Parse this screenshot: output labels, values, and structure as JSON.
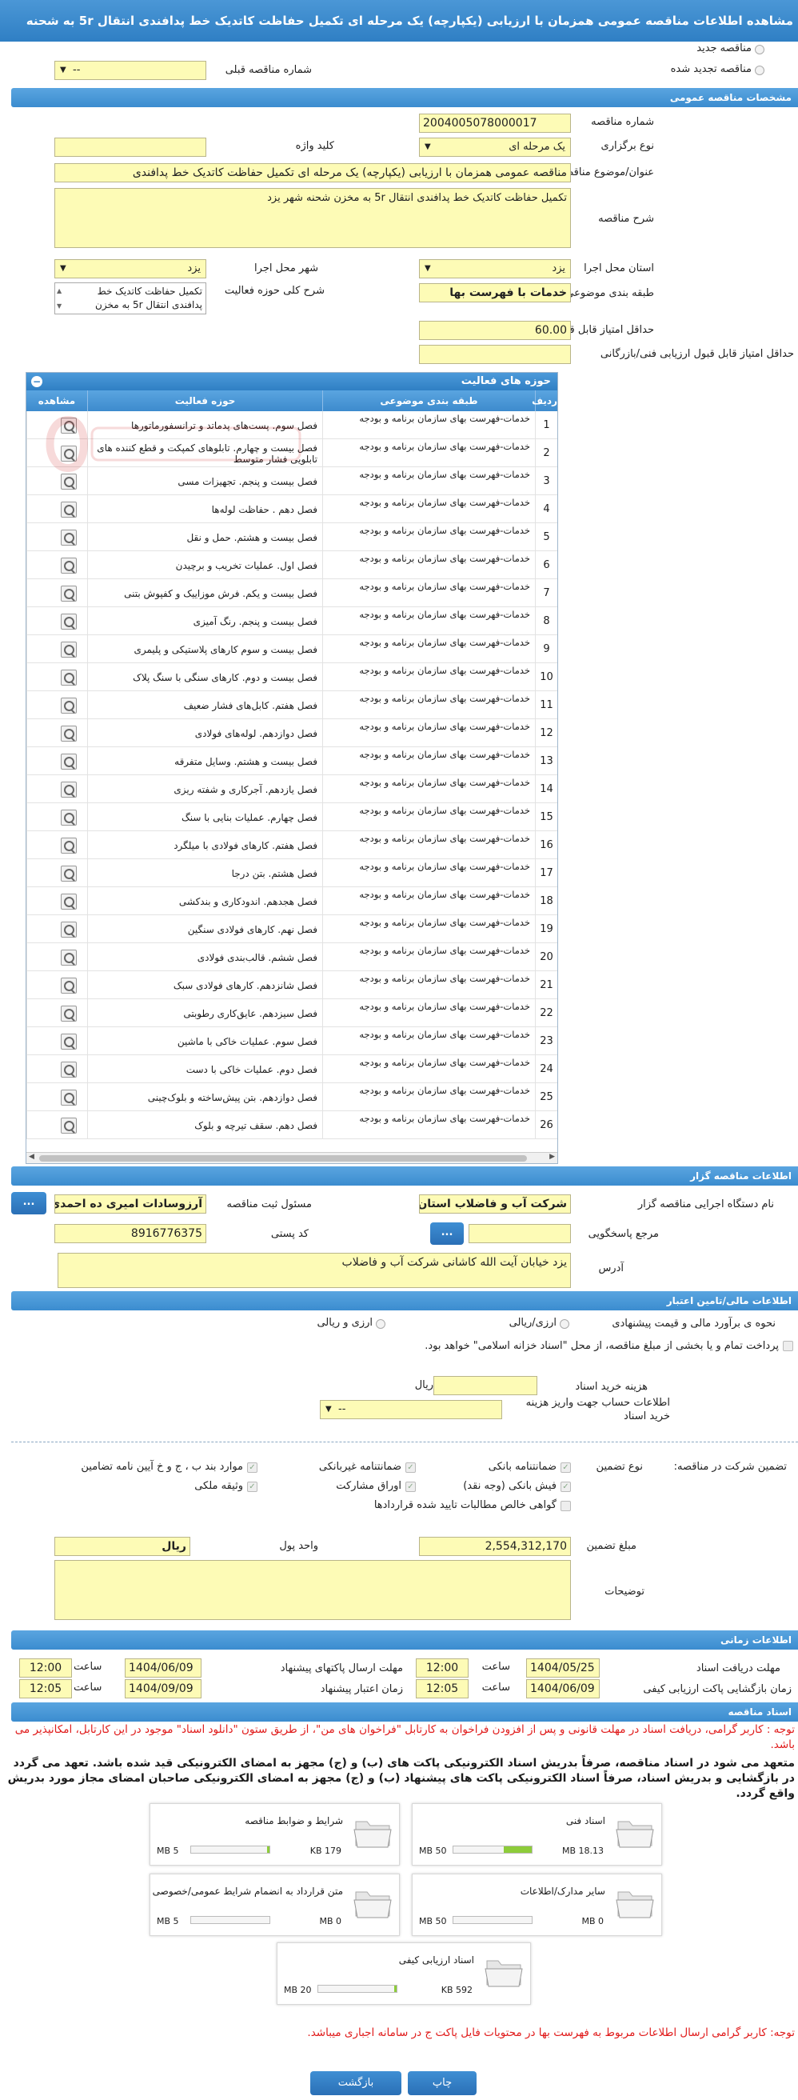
{
  "title": "مشاهده اطلاعات مناقصه عمومی همزمان با ارزیابی (یکپارچه) یک مرحله ای تکمیل حفاظت کاتدیک خط پدافندی انتقال 5r به شحنه",
  "top": {
    "new_tender": "مناقصه جدید",
    "renewed_tender": "مناقصه تجدید شده",
    "prev_number_label": "شماره مناقصه قبلی",
    "prev_number_value": "--"
  },
  "general": {
    "section": "مشخصات مناقصه عمومی",
    "number_label": "شماره مناقصه",
    "number_value": "2004005078000017",
    "type_label": "نوع برگزاری",
    "type_value": "یک مرحله ای",
    "keyword_label": "کلید واژه",
    "keyword_value": "",
    "subject_label": "عنوان/موضوع مناقصه",
    "subject_value": "مناقصه عمومی همزمان با ارزیابی (یکپارچه) یک مرحله ای تکمیل حفاظت کاتدیک خط پدافندی",
    "desc_label": "شرح مناقصه",
    "desc_value": "تکمیل حفاظت کاتدیک خط پدافندی انتقال 5r به مخزن شحنه شهر یزد",
    "province_label": "استان محل اجرا",
    "province_value": "یزد",
    "city_label": "شهر محل اجرا",
    "city_value": "یزد",
    "category_label": "طبقه بندی موضوعی",
    "category_value": "خدمات با فهرست بها",
    "activity_label": "شرح کلی حوزه فعالیت",
    "activity_value": "تکمیل حفاظت کاتدیک خط پدافندی انتقال 5r به مخزن",
    "min_quality_label": "حداقل امتیاز قابل قبول ارزیابی کیفی",
    "min_quality_value": "60.00",
    "min_tech_label": "حداقل امتیاز قابل قبول ارزیابی فنی/بازرگانی",
    "min_tech_value": ""
  },
  "grid": {
    "title": "حوزه های فعالیت",
    "col_row": "ردیف",
    "col_category": "طبقه بندی موضوعی",
    "col_activity": "حوزه فعالیت",
    "col_view": "مشاهده",
    "rows": [
      {
        "n": "1",
        "cat": "خدمات-فهرست بهای سازمان برنامه و بودجه",
        "act": "فصل سوم. پست‌های پدماتد و ترانسفورماتورها"
      },
      {
        "n": "2",
        "cat": "خدمات-فهرست بهای سازمان برنامه و بودجه",
        "act": "فصل بیست و چهارم. تابلوهای کمپکت و قطع کننده های تابلویی فشار متوسط"
      },
      {
        "n": "3",
        "cat": "خدمات-فهرست بهای سازمان برنامه و بودجه",
        "act": "فصل بیست و پنجم. تجهیزات مسی"
      },
      {
        "n": "4",
        "cat": "خدمات-فهرست بهای سازمان برنامه و بودجه",
        "act": "فصل دهم . حفاظت لوله‌ها"
      },
      {
        "n": "5",
        "cat": "خدمات-فهرست بهای سازمان برنامه و بودجه",
        "act": "فصل بیست و هشتم. حمل و نقل"
      },
      {
        "n": "6",
        "cat": "خدمات-فهرست بهای سازمان برنامه و بودجه",
        "act": "فصل اول. عملیات تخریب و برچیدن"
      },
      {
        "n": "7",
        "cat": "خدمات-فهرست بهای سازمان برنامه و بودجه",
        "act": "فصل بیست و یکم. فرش موزاییک و کفپوش بتنی"
      },
      {
        "n": "8",
        "cat": "خدمات-فهرست بهای سازمان برنامه و بودجه",
        "act": "فصل بیست و پنجم. رنگ آمیزی"
      },
      {
        "n": "9",
        "cat": "خدمات-فهرست بهای سازمان برنامه و بودجه",
        "act": "فصل بیست و سوم کارهای پلاستیکی و پلیمری"
      },
      {
        "n": "10",
        "cat": "خدمات-فهرست بهای سازمان برنامه و بودجه",
        "act": "فصل بیست و دوم. کارهای سنگی با سنگ پلاک"
      },
      {
        "n": "11",
        "cat": "خدمات-فهرست بهای سازمان برنامه و بودجه",
        "act": "فصل هفتم. کابل‌های فشار ضعیف"
      },
      {
        "n": "12",
        "cat": "خدمات-فهرست بهای سازمان برنامه و بودجه",
        "act": "فصل دوازدهم. لوله‌های فولادی"
      },
      {
        "n": "13",
        "cat": "خدمات-فهرست بهای سازمان برنامه و بودجه",
        "act": "فصل بیست و هشتم. وسایل متفرقه"
      },
      {
        "n": "14",
        "cat": "خدمات-فهرست بهای سازمان برنامه و بودجه",
        "act": "فصل یازدهم. آجرکاری و شفته ریزی"
      },
      {
        "n": "15",
        "cat": "خدمات-فهرست بهای سازمان برنامه و بودجه",
        "act": "فصل چهارم. عملیات بنایی با سنگ"
      },
      {
        "n": "16",
        "cat": "خدمات-فهرست بهای سازمان برنامه و بودجه",
        "act": "فصل هفتم. کارهای فولادی با میلگرد"
      },
      {
        "n": "17",
        "cat": "خدمات-فهرست بهای سازمان برنامه و بودجه",
        "act": "فصل هشتم. بتن درجا"
      },
      {
        "n": "18",
        "cat": "خدمات-فهرست بهای سازمان برنامه و بودجه",
        "act": "فصل هجدهم. اندودکاری و بندکشی"
      },
      {
        "n": "19",
        "cat": "خدمات-فهرست بهای سازمان برنامه و بودجه",
        "act": "فصل نهم. کارهای فولادی سنگین"
      },
      {
        "n": "20",
        "cat": "خدمات-فهرست بهای سازمان برنامه و بودجه",
        "act": "فصل ششم. قالب‌بندی فولادی"
      },
      {
        "n": "21",
        "cat": "خدمات-فهرست بهای سازمان برنامه و بودجه",
        "act": "فصل شانزدهم. کارهای فولادی سبک"
      },
      {
        "n": "22",
        "cat": "خدمات-فهرست بهای سازمان برنامه و بودجه",
        "act": "فصل سیزدهم. عایق‌کاری رطوبتی"
      },
      {
        "n": "23",
        "cat": "خدمات-فهرست بهای سازمان برنامه و بودجه",
        "act": "فصل سوم. عملیات خاکی با ماشین"
      },
      {
        "n": "24",
        "cat": "خدمات-فهرست بهای سازمان برنامه و بودجه",
        "act": "فصل دوم. عملیات خاکی با دست"
      },
      {
        "n": "25",
        "cat": "خدمات-فهرست بهای سازمان برنامه و بودجه",
        "act": "فصل دوازدهم. بتن پیش‌ساخته و بلوک‌چینی"
      },
      {
        "n": "26",
        "cat": "خدمات-فهرست بهای سازمان برنامه و بودجه",
        "act": "فصل دهم. سقف تیرچه و بلوک"
      }
    ]
  },
  "org": {
    "section": "اطلاعات مناقصه گزار",
    "org_label": "نام دستگاه اجرایی مناقصه گزار",
    "org_value": "شرکت آب و فاضلاب استان",
    "responsible_label": "مسئول ثبت مناقصه",
    "responsible_value": "آرزوسادات امیری ده احمدی",
    "ref_label": "مرجع پاسخگویی",
    "ref_value": "",
    "dots": "...",
    "postal_label": "کد پستی",
    "postal_value": "8916776375",
    "address_label": "آدرس",
    "address_value": "یزد خیابان آیت الله کاشانی شرکت آب و فاضلاب"
  },
  "finance": {
    "section": "اطلاعات مالی/تامین اعتبار",
    "estimate_label": "نحوه ی برآورد مالی و قیمت پیشنهادی",
    "rial_opt": "ارزی/ریالی",
    "rial2_opt": "ارزی و ریالی",
    "treasury_text": "پرداخت تمام و یا بخشی از مبلغ مناقصه، از محل \"اسناد خزانه اسلامی\" خواهد بود.",
    "doc_fee_label": "هزینه خرید اسناد",
    "doc_fee_unit": "ریال",
    "account_label": "اطلاعات حساب جهت واریز هزینه خرید اسناد",
    "account_value": "--",
    "guarantee_label": "تضمین شرکت در مناقصه:",
    "guarantee_type": "نوع تضمین",
    "g1": "ضمانتنامه بانکی",
    "g2": "ضمانتنامه غیربانکی",
    "g3": "موارد بند ب ، ج و خ آیین نامه تضامین",
    "g4": "فیش بانکی (وجه نقد)",
    "g5": "اوراق مشارکت",
    "g6": "وثیقه ملکی",
    "g7": "گواهی خالص مطالبات تایید شده قراردادها",
    "amount_label": "مبلغ تضمین",
    "amount_value": "2,554,312,170",
    "currency_label": "واحد پول",
    "currency_value": "ریال",
    "notes_label": "توضیحات",
    "notes_value": ""
  },
  "time": {
    "section": "اطلاعات زمانی",
    "receive_label": "مهلت دریافت اسناد",
    "receive_date": "1404/05/25",
    "receive_time": "12:00",
    "send_label": "مهلت ارسال پاکتهای پیشنهاد",
    "send_date": "1404/06/09",
    "send_time": "12:00",
    "open_label": "زمان بازگشایی پاکت ارزیابی کیفی",
    "open_date": "1404/06/09",
    "open_time": "12:05",
    "validity_label": "زمان اعتبار پیشنهاد",
    "validity_date": "1404/09/09",
    "validity_time": "12:05",
    "time_word": "ساعت"
  },
  "docs": {
    "section": "اسناد مناقصه",
    "note": "توجه : کاربر گرامی، دریافت اسناد در مهلت قانونی و پس از افزودن فراخوان به کارتابل \"فراخوان های من\"، از طریق ستون \"دانلود اسناد\" موجود در این کارتابل، امکانپذیر می باشد.",
    "commit": "متعهد می شود در اسناد مناقصه، صرفاً بدریش اسناد الکترونیکی پاکت های (ب) و (ج) مجهز به امضای الکترونیکی قید شده باشد. تعهد می گردد در بازگشایی و بدریش اسناد، صرفاً اسناد الکترونیکی پاکت های پیشنهاد (ب) و (ج) مجهز به امضای الکترونیکی صاحبان امضای مجاز مورد بدریش واقع گردد.",
    "cards": [
      {
        "title": "شرایط و ضوابط مناقصه",
        "used": "179 KB",
        "max": "5 MB",
        "pct": 3.5
      },
      {
        "title": "اسناد فنی",
        "used": "18.13 MB",
        "max": "50 MB",
        "pct": 36
      },
      {
        "title": "متن قرارداد به انضمام شرایط عمومی/خصوصی",
        "used": "0 MB",
        "max": "5 MB",
        "pct": 0
      },
      {
        "title": "سایر مدارک/اطلاعات",
        "used": "0 MB",
        "max": "50 MB",
        "pct": 0
      },
      {
        "title": "اسناد ارزیابی کیفی",
        "used": "592 KB",
        "max": "20 MB",
        "pct": 3
      }
    ],
    "footer_note": "توجه: کاربر گرامی ارسال اطلاعات مربوط به فهرست بها در محتویات فایل پاکت ج در سامانه اجباری میباشد."
  },
  "buttons": {
    "print": "چاپ",
    "back": "بازگشت"
  }
}
